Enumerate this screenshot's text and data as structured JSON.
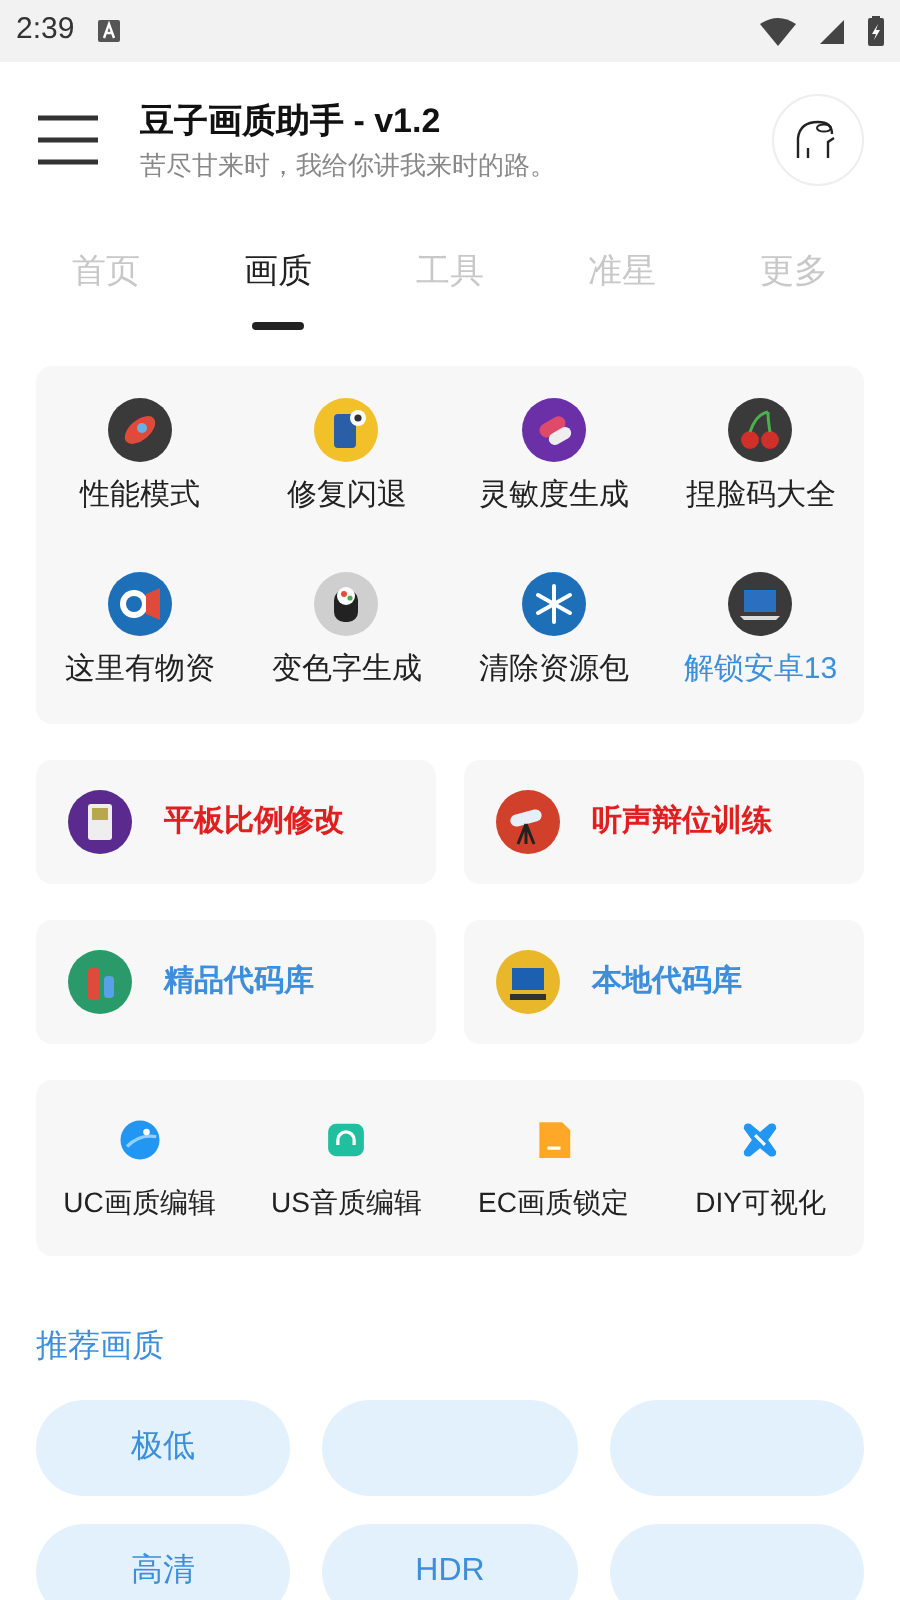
{
  "status_bar": {
    "time": "2:39"
  },
  "header": {
    "title": "豆子画质助手 - v1.2",
    "subtitle": "苦尽甘来时，我给你讲我来时的路。"
  },
  "tabs": [
    {
      "label": "首页",
      "selected": false
    },
    {
      "label": "画质",
      "selected": true
    },
    {
      "label": "工具",
      "selected": false
    },
    {
      "label": "准星",
      "selected": false
    },
    {
      "label": "更多",
      "selected": false
    }
  ],
  "grid_items": [
    {
      "label": "性能模式",
      "color": "#222222"
    },
    {
      "label": "修复闪退",
      "color": "#222222"
    },
    {
      "label": "灵敏度生成",
      "color": "#222222"
    },
    {
      "label": "捏脸码大全",
      "color": "#222222"
    },
    {
      "label": "这里有物资",
      "color": "#222222"
    },
    {
      "label": "变色字生成",
      "color": "#222222"
    },
    {
      "label": "清除资源包",
      "color": "#222222"
    },
    {
      "label": "解锁安卓13",
      "color": "#3d8fdc"
    }
  ],
  "feature_cards": [
    {
      "label": "平板比例修改",
      "color": "#e02020"
    },
    {
      "label": "听声辩位训练",
      "color": "#e02020"
    },
    {
      "label": "精品代码库",
      "color": "#3d8fdc"
    },
    {
      "label": "本地代码库",
      "color": "#3d8fdc"
    }
  ],
  "editors": [
    {
      "label": "UC画质编辑"
    },
    {
      "label": "US音质编辑"
    },
    {
      "label": "EC画质锁定"
    },
    {
      "label": "DIY可视化"
    }
  ],
  "recommended": {
    "title": "推荐画质",
    "chips": [
      {
        "kind": "text",
        "label": "极低"
      },
      {
        "kind": "blank"
      },
      {
        "kind": "blank"
      },
      {
        "kind": "text",
        "label": "高清"
      },
      {
        "kind": "text",
        "label": "HDR"
      },
      {
        "kind": "blank"
      }
    ]
  }
}
